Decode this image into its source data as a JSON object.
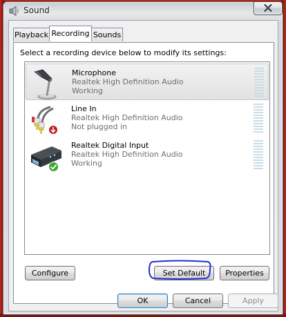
{
  "window": {
    "title": "Sound"
  },
  "tabs": [
    {
      "label": "Playback"
    },
    {
      "label": "Recording"
    },
    {
      "label": "Sounds"
    }
  ],
  "instruction": "Select a recording device below to modify its settings:",
  "devices": [
    {
      "name": "Microphone",
      "driver": "Realtek High Definition Audio",
      "status": "Working",
      "icon": "microphone-icon",
      "selected": true
    },
    {
      "name": "Line In",
      "driver": "Realtek High Definition Audio",
      "status": "Not plugged in",
      "icon": "line-in-cable-icon",
      "badge": "red-down-arrow"
    },
    {
      "name": "Realtek Digital Input",
      "driver": "Realtek High Definition Audio",
      "status": "Working",
      "icon": "digital-input-device-icon",
      "badge": "green-check"
    }
  ],
  "buttons": {
    "configure": "Configure",
    "set_default": "Set Default",
    "properties": "Properties",
    "ok": "OK",
    "cancel": "Cancel",
    "apply": "Apply"
  },
  "colors": {
    "annotation": "#1f2fd0",
    "meter": "#c9dce6"
  }
}
